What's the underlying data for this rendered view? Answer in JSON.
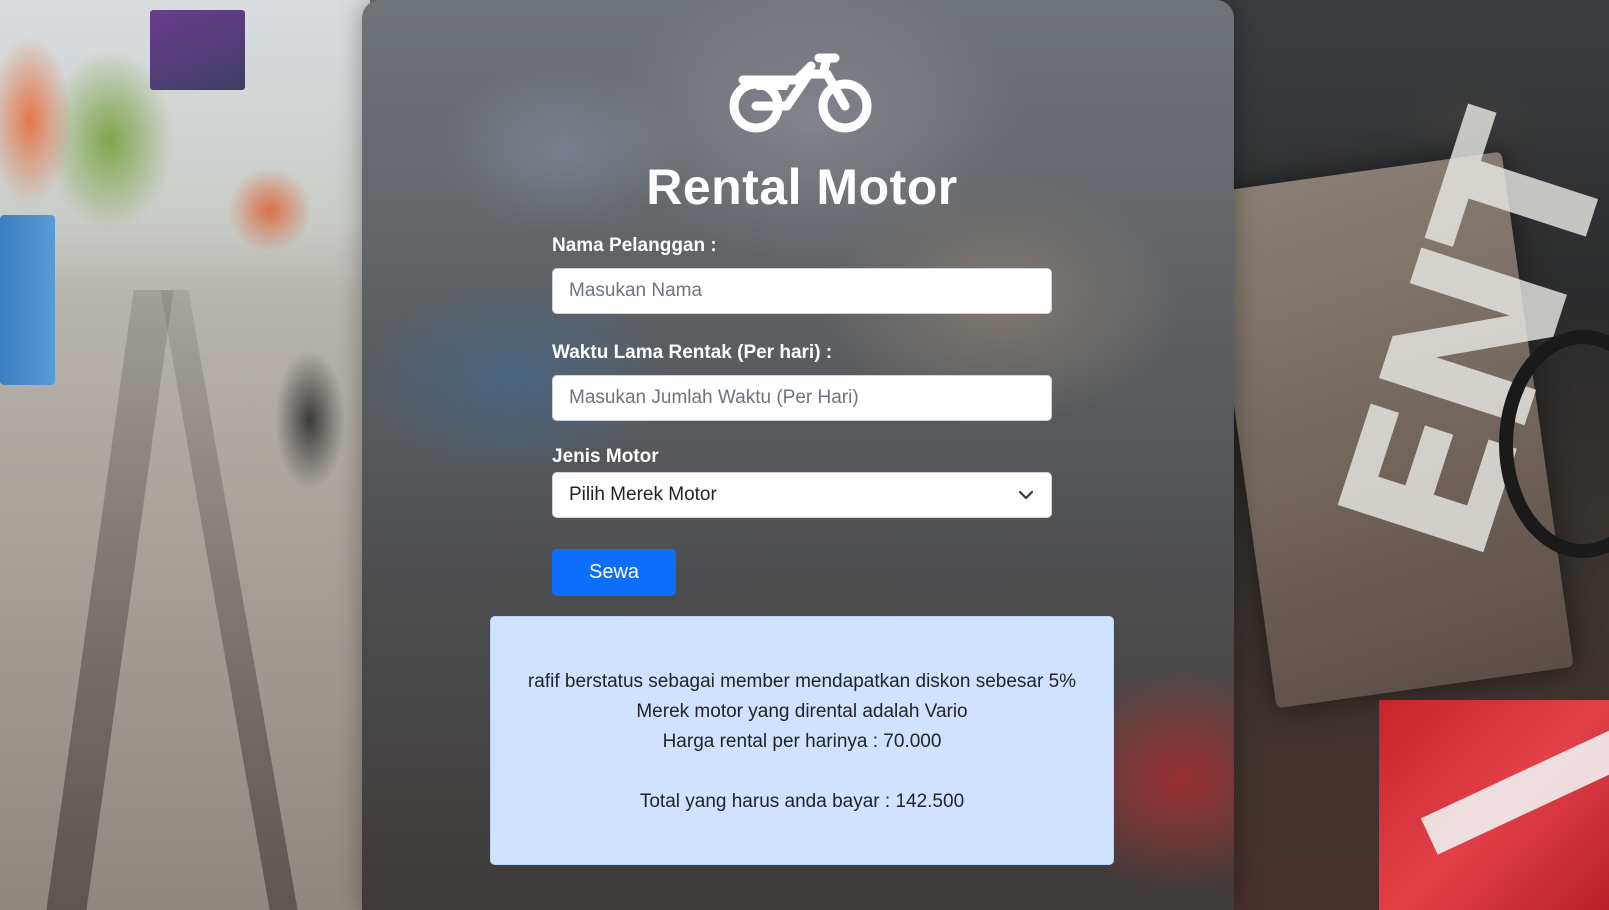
{
  "app": {
    "title": "Rental Motor",
    "logo_icon": "motorcycle-icon"
  },
  "form": {
    "name_label": "Nama Pelanggan :",
    "name_placeholder": "Masukan Nama",
    "name_value": "",
    "duration_label": "Waktu Lama Rentak (Per hari) :",
    "duration_placeholder": "Masukan Jumlah Waktu (Per Hari)",
    "duration_value": "",
    "type_label": "Jenis Motor",
    "type_selected": "Pilih Merek Motor",
    "type_icon": "chevron-down-icon",
    "submit_label": "Sewa"
  },
  "result": {
    "line1": "rafif berstatus sebagai member mendapatkan diskon sebesar 5%",
    "line2": "Merek motor yang dirental adalah Vario",
    "line3": "Harga rental per harinya : 70.000",
    "line4": "Total yang harus anda bayar : 142.500"
  },
  "colors": {
    "primary": "#0d6efd",
    "alert_bg": "#cfe2ff",
    "title": "#ffffff"
  }
}
